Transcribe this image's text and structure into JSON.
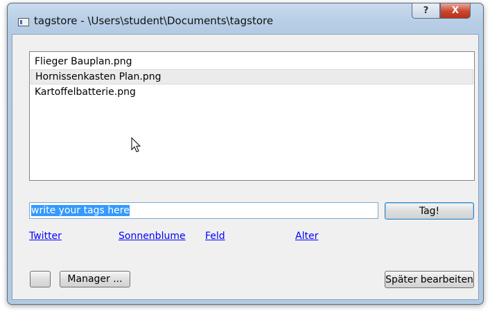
{
  "window": {
    "title": "tagstore - \\Users\\student\\Documents\\tagstore",
    "help_label": "?",
    "close_label": "X"
  },
  "file_list": {
    "items": [
      {
        "label": "Flieger Bauplan.png",
        "selected": false
      },
      {
        "label": "Hornissenkasten Plan.png",
        "selected": true
      },
      {
        "label": "Kartoffelbatterie.png",
        "selected": false
      }
    ]
  },
  "tag_input": {
    "value": "write your tags here"
  },
  "buttons": {
    "tag_label": "Tag!",
    "manager_label": "Manager ...",
    "later_label": "Später bearbeiten",
    "small_label": ""
  },
  "tag_links": [
    {
      "label": "Twitter"
    },
    {
      "label": "Sonnenblume"
    },
    {
      "label": "Feld"
    },
    {
      "label": "Alter"
    }
  ],
  "colors": {
    "title_bar": "#b9cfe7",
    "selection": "#3399ff",
    "link": "#0000ff",
    "close_button": "#c9452d"
  }
}
